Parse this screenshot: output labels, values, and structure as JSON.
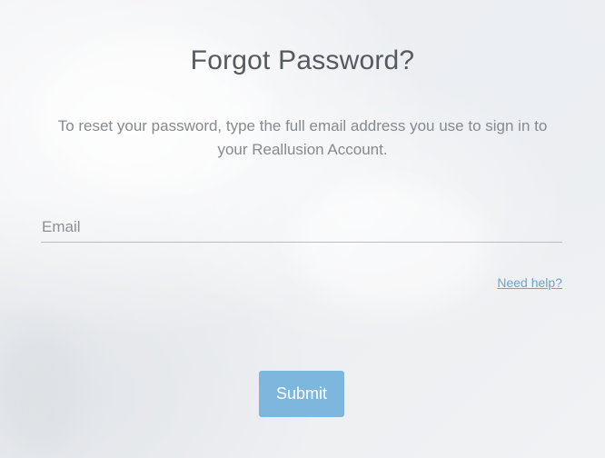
{
  "page": {
    "title": "Forgot Password?",
    "description": "To reset your password, type the full email address you use to sign in to your Reallusion Account."
  },
  "form": {
    "email_placeholder": "Email",
    "email_value": "",
    "help_link": "Need help?",
    "submit_label": "Submit"
  },
  "colors": {
    "accent": "#7db7de",
    "link": "#6ea3c7",
    "title": "#555a5f",
    "text": "#858a8f"
  }
}
